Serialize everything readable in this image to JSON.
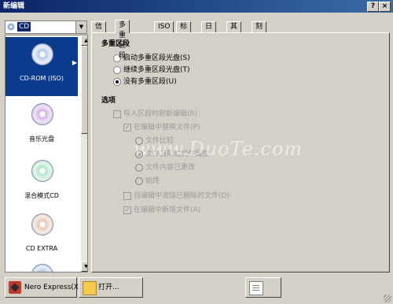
{
  "window": {
    "title": "新编辑",
    "help": "?",
    "close": "×"
  },
  "combo": {
    "value": "CD",
    "arrow": "▼"
  },
  "sidebar": {
    "items": [
      {
        "label": "CD-ROM (ISO)",
        "selected": true
      },
      {
        "label": "音乐光盘"
      },
      {
        "label": "混合模式CD"
      },
      {
        "label": "CD EXTRA"
      }
    ],
    "caret": "▶",
    "scroll_up": "▲",
    "scroll_down": "▼"
  },
  "tabs": [
    "信息",
    "多重区段",
    "ISO",
    "标签",
    "日期",
    "其它",
    "刻录"
  ],
  "multisession": {
    "heading": "多重区段",
    "options": [
      {
        "label": "启动多重区段光盘(S)",
        "selected": false
      },
      {
        "label": "继续多重区段光盘(T)",
        "selected": false
      },
      {
        "label": "没有多重区段(U)",
        "selected": true
      }
    ]
  },
  "options": {
    "heading": "选项",
    "import_label": "导入区段时刷新编辑(R)",
    "replace_label": "在编辑中替换文件(P)",
    "sub_options": [
      "文件比较",
      "文件日期或文件属性",
      "文件内容已更改",
      "始终"
    ],
    "remove_deleted_label": "自编辑中清除已删除的文件(D)",
    "add_new_label": "在编辑中新增文件(A)"
  },
  "watermark": "www.DuoTe.com",
  "buttons": {
    "nero": "Nero Express(X)",
    "open": "打开..."
  },
  "check_mark": "✓"
}
